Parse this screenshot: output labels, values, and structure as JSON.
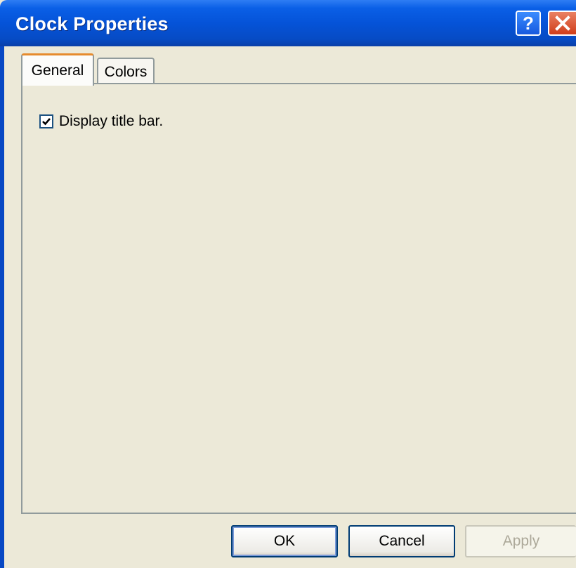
{
  "window": {
    "title": "Clock Properties",
    "help_glyph": "?",
    "accent_color": "#0553d8"
  },
  "tabs": [
    {
      "label": "General",
      "selected": true
    },
    {
      "label": "Colors",
      "selected": false
    }
  ],
  "general": {
    "display_title_bar": {
      "label": "Display title bar.",
      "checked": true
    }
  },
  "buttons": {
    "ok": "OK",
    "cancel": "Cancel",
    "apply": "Apply"
  }
}
